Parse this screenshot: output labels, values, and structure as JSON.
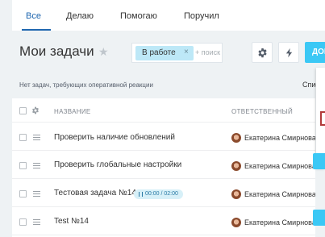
{
  "tabs": [
    {
      "label": "Все",
      "active": true
    },
    {
      "label": "Делаю",
      "active": false
    },
    {
      "label": "Помогаю",
      "active": false
    },
    {
      "label": "Поручил",
      "active": false
    }
  ],
  "page": {
    "title": "Мои задачи"
  },
  "filter": {
    "chip_label": "В работе",
    "chip_remove": "×",
    "search_placeholder": "+ поиск"
  },
  "toolbar": {
    "add_label": "ДОБАВИТЬ"
  },
  "notice": {
    "text": "Нет задач, требующих оперативной реакции",
    "right_label": "Список"
  },
  "grid": {
    "columns": {
      "name": "НАЗВАНИЕ",
      "responsible": "ОТВЕТСТВЕННЫЙ"
    },
    "rows": [
      {
        "title": "Проверить наличие обновлений",
        "responsible": "Екатерина Смирнова"
      },
      {
        "title": "Проверить глобальные настройки",
        "responsible": "Екатерина Смирнова"
      },
      {
        "title": "Тестовая задача №14",
        "responsible": "Екатерина Смирнова",
        "timer": "00:00 / 02:00"
      },
      {
        "title": "Test №14",
        "responsible": "Екатерина Смирнова"
      }
    ]
  },
  "colors": {
    "accent": "#2067b0",
    "add_button": "#3bc8f5",
    "filter_chip": "#bde8f7"
  }
}
